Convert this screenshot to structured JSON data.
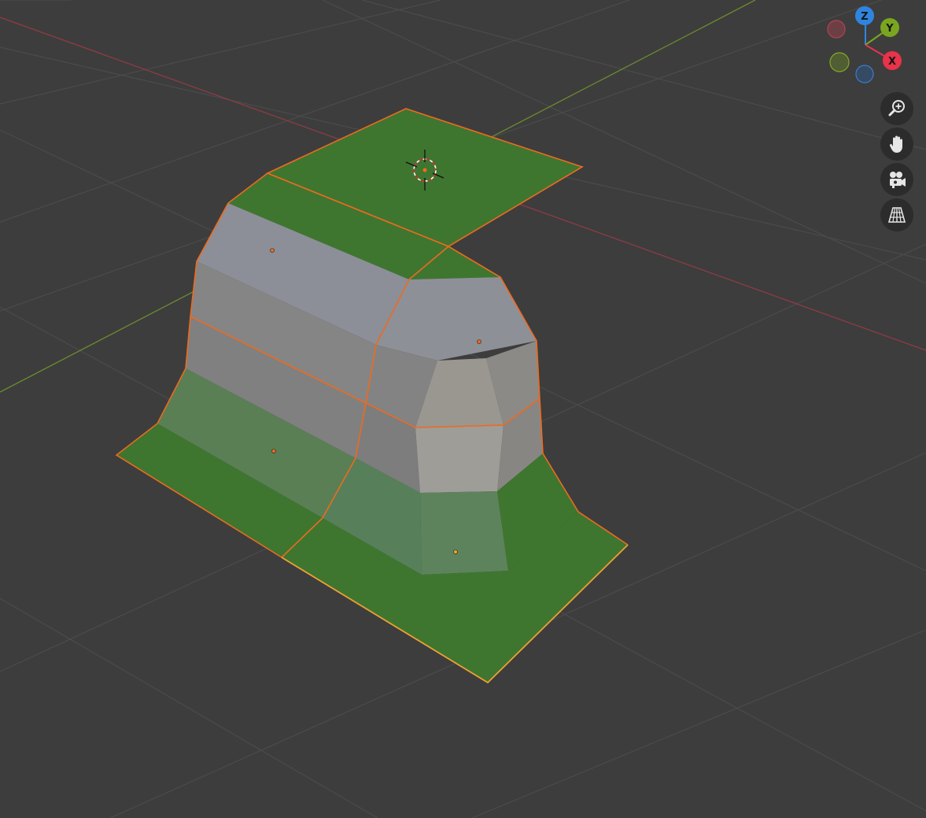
{
  "app": "Blender",
  "viewport": {
    "background": "#3d3d3d",
    "grid_color": "#4a4a4a",
    "x_axis_color": "#8e3b44",
    "y_axis_color": "#6b8b2e",
    "mesh": {
      "selected_face_color": "#3e7630",
      "unselected_face_color": "#8a8a8a",
      "edge_highlight_color": "#ee6a1e",
      "active_edge_color": "#f0a030"
    }
  },
  "navigation_gizmo": {
    "z_label": "Z",
    "y_label": "Y",
    "x_label": "X",
    "z_color": "#2f84e0",
    "y_color": "#7aa61f",
    "x_color": "#e8334a"
  },
  "nav_buttons": [
    {
      "name": "zoom",
      "icon": "zoom-magnifier-icon"
    },
    {
      "name": "pan",
      "icon": "hand-icon"
    },
    {
      "name": "camera",
      "icon": "camera-icon"
    },
    {
      "name": "perspective",
      "icon": "grid-perspective-icon"
    }
  ]
}
